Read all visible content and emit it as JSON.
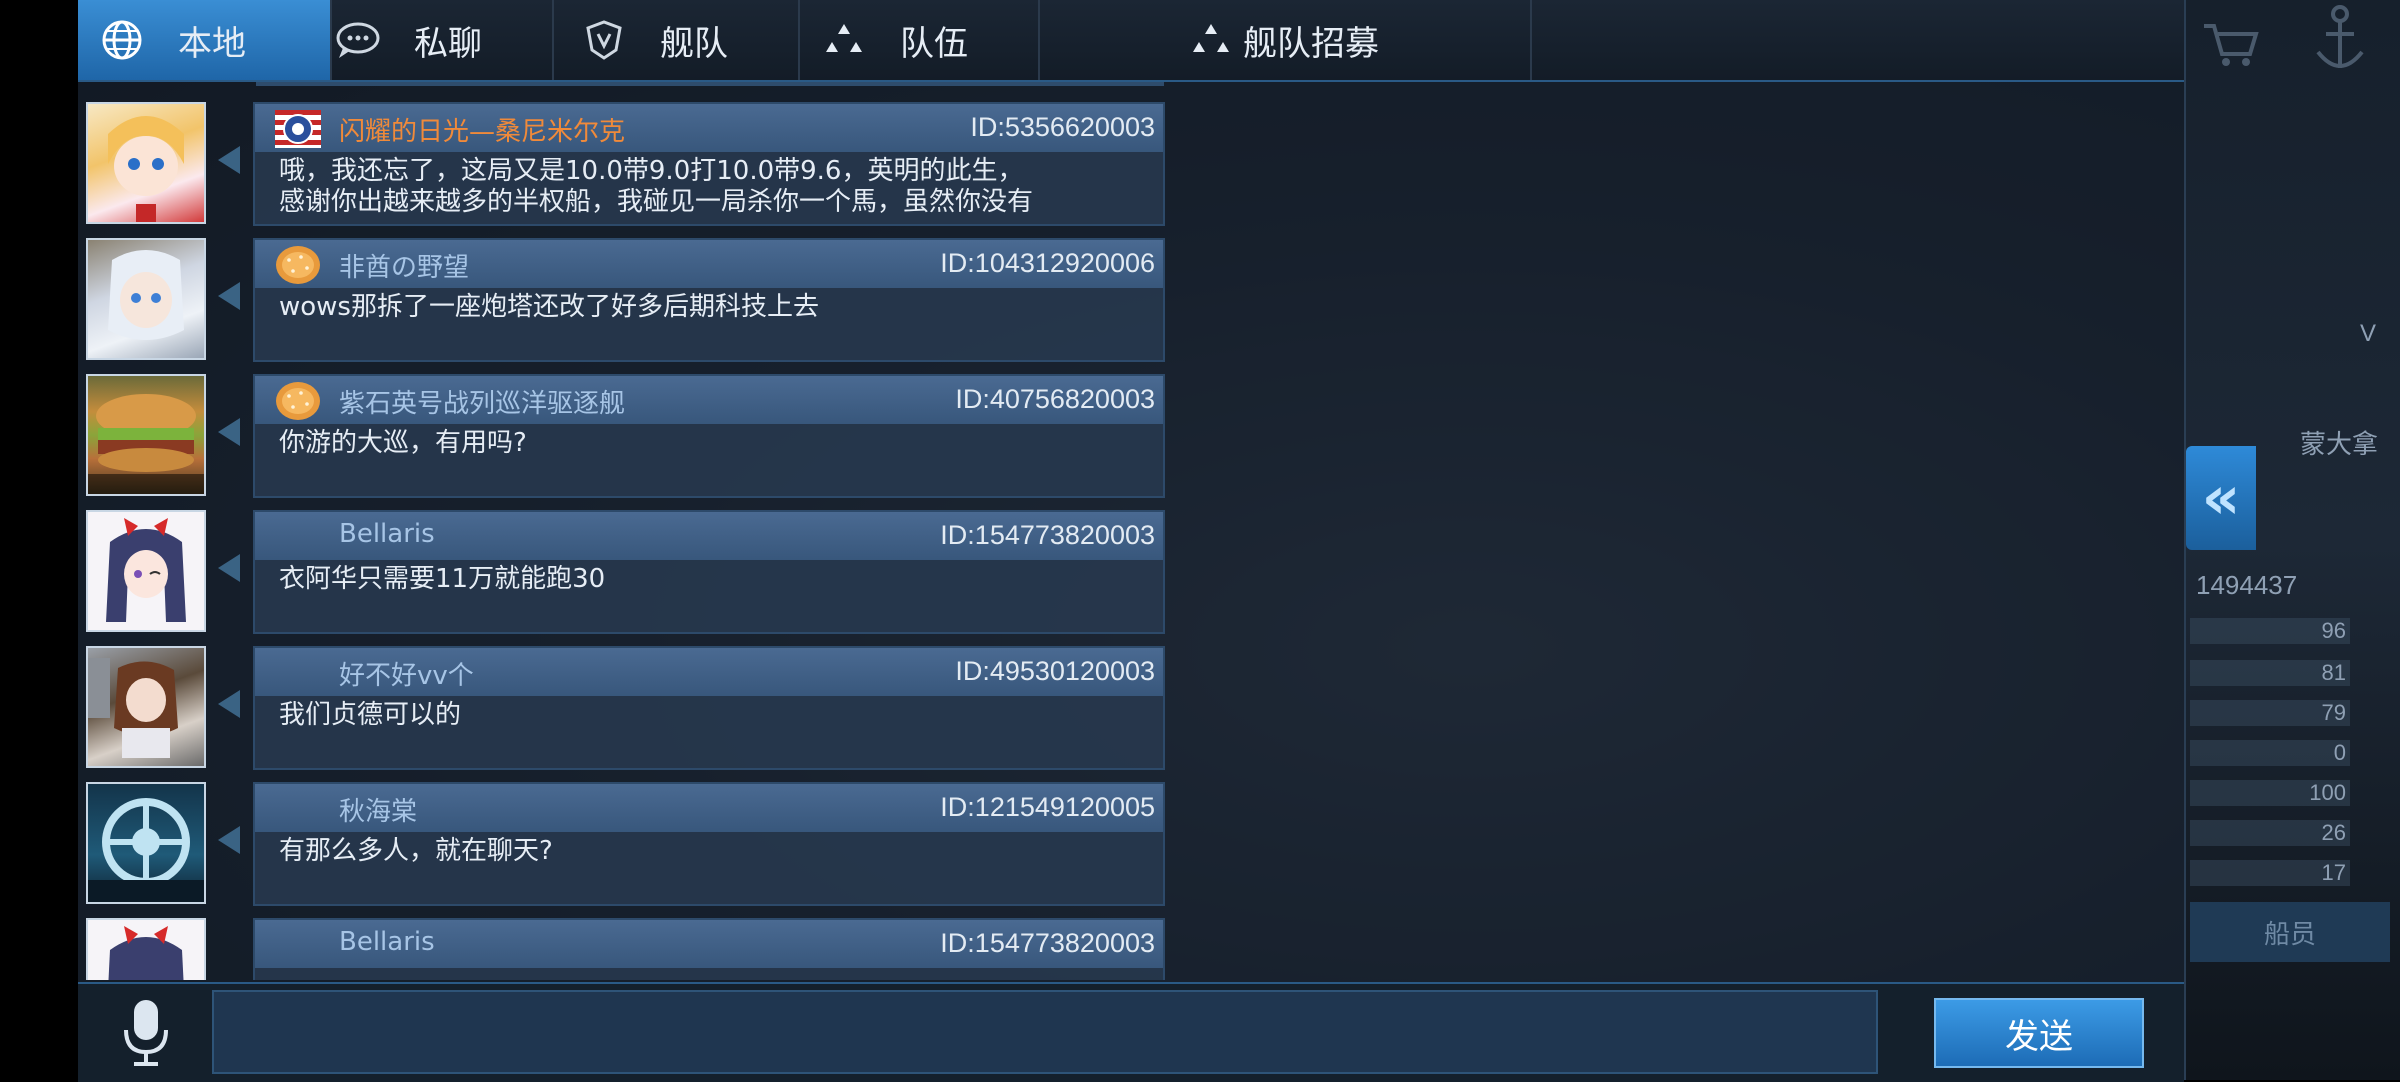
{
  "tabs": [
    {
      "label": "本地",
      "icon": "globe-icon",
      "active": true
    },
    {
      "label": "私聊",
      "icon": "speech-bubble-icon",
      "active": false
    },
    {
      "label": "舰队",
      "icon": "fleet-shield-icon",
      "active": false
    },
    {
      "label": "队伍",
      "icon": "team-dots-icon",
      "active": false
    },
    {
      "label": "舰队招募",
      "icon": "recruit-dots-icon",
      "active": false
    }
  ],
  "messages": [
    {
      "name": "闪耀的日光—桑尼米尔克",
      "vip": true,
      "badge": "us-flag-badge",
      "id": "ID:5356620003",
      "text": "哦，我还忘了，这局又是10.0带9.0打10.0带9.6，英明的此生，感谢你出越来越多的半权船，我碰见一局杀你一个馬，虽然你没有"
    },
    {
      "name": "非酋の野望",
      "vip": false,
      "badge": "bread-badge",
      "id": "ID:104312920006",
      "text": "wows那拆了一座炮塔还改了好多后期科技上去"
    },
    {
      "name": "紫石英号战列巡洋驱逐舰",
      "vip": false,
      "badge": "bread-badge",
      "id": "ID:40756820003",
      "text": "你游的大巡，有用吗?"
    },
    {
      "name": "Bellaris",
      "vip": false,
      "badge": "",
      "id": "ID:154773820003",
      "text": "衣阿华只需要11万就能跑30"
    },
    {
      "name": "好不好vv个",
      "vip": false,
      "badge": "",
      "id": "ID:49530120003",
      "text": "我们贞德可以的"
    },
    {
      "name": "秋海棠",
      "vip": false,
      "badge": "",
      "id": "ID:121549120005",
      "text": "有那么多人，就在聊天?"
    },
    {
      "name": "Bellaris",
      "vip": false,
      "badge": "",
      "id": "ID:154773820003",
      "text": ""
    }
  ],
  "input": {
    "value": "",
    "placeholder": ""
  },
  "send_label": "发送",
  "hud": {
    "id_value": "1494437",
    "stats": [
      "96",
      "81",
      "79",
      "0",
      "100",
      "26",
      "17"
    ],
    "crew_label": "船员",
    "ship_name_partial": "蒙大拿",
    "v_mark": "V"
  },
  "colors": {
    "accent": "#2f86d0",
    "vip_name": "#f08a3a",
    "name": "#a7c5e6"
  }
}
